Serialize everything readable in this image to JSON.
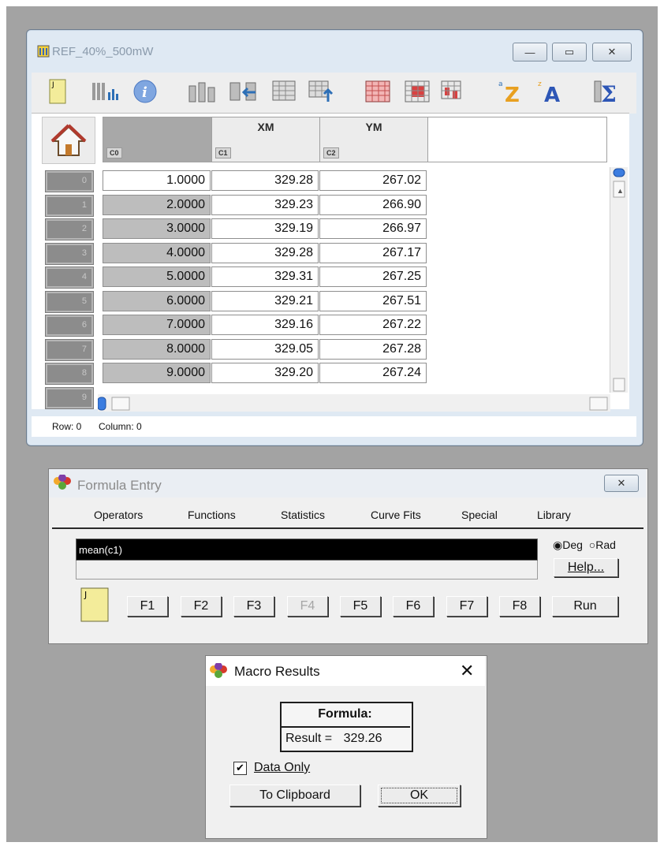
{
  "data_window": {
    "title": "REF_40%_500mW",
    "controls": {
      "minimize": "—",
      "restore": "▭",
      "close": "✕"
    },
    "toolbar_icons": [
      "notepad-icon",
      "histogram-icon",
      "info-icon",
      "column-chart-icon",
      "insert-column-icon",
      "table-insert-icon",
      "table-up-icon",
      "red-grid-icon",
      "red-grid-2-icon",
      "red-grid-3-icon",
      "sort-az-icon",
      "sort-za-icon",
      "sigma-icon"
    ],
    "columns": [
      {
        "name": "",
        "id": "C0"
      },
      {
        "name": "XM",
        "id": "C1"
      },
      {
        "name": "YM",
        "id": "C2"
      }
    ],
    "row_labels": [
      "0",
      "1",
      "2",
      "3",
      "4",
      "5",
      "6",
      "7",
      "8",
      "9"
    ],
    "rows": [
      [
        "1.0000",
        "329.28",
        "267.02"
      ],
      [
        "2.0000",
        "329.23",
        "266.90"
      ],
      [
        "3.0000",
        "329.19",
        "266.97"
      ],
      [
        "4.0000",
        "329.28",
        "267.17"
      ],
      [
        "5.0000",
        "329.31",
        "267.25"
      ],
      [
        "6.0000",
        "329.21",
        "267.51"
      ],
      [
        "7.0000",
        "329.16",
        "267.22"
      ],
      [
        "8.0000",
        "329.05",
        "267.28"
      ],
      [
        "9.0000",
        "329.20",
        "267.24"
      ]
    ],
    "status": {
      "row": "Row: 0",
      "column": "Column: 0"
    }
  },
  "formula_entry": {
    "title": "Formula Entry",
    "close": "✕",
    "menu": [
      "Operators",
      "Functions",
      "Statistics",
      "Curve Fits",
      "Special",
      "Library"
    ],
    "formula": "mean(c1)",
    "angle_options": {
      "deg": "Deg",
      "rad": "Rad",
      "selected": "Deg"
    },
    "help_label": "Help...",
    "function_keys": [
      "F1",
      "F2",
      "F3",
      "F4",
      "F5",
      "F6",
      "F7",
      "F8"
    ],
    "run_label": "Run"
  },
  "macro_results": {
    "title": "Macro Results",
    "close": "✕",
    "formula_label": "Formula:",
    "result_label": "Result =",
    "result_value": "329.26",
    "data_only_label": "Data Only",
    "data_only_checked": true,
    "clipboard_label": "To Clipboard",
    "ok_label": "OK"
  }
}
